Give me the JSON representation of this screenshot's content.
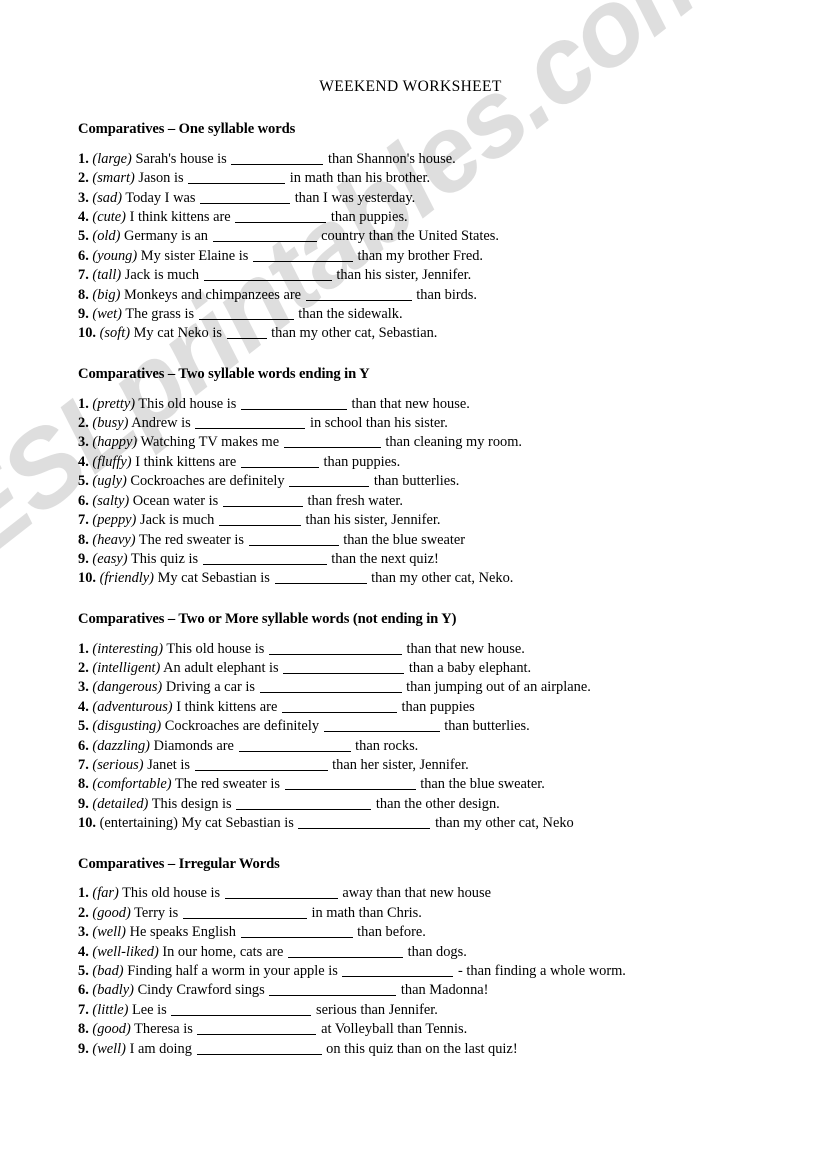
{
  "document": {
    "title": "WEEKEND WORKSHEET",
    "watermark": "ESLprintables.com"
  },
  "sections": [
    {
      "heading": "Comparatives – One syllable words",
      "items": [
        {
          "num": "1.",
          "cue": "(large)",
          "cue_italic": true,
          "before": "Sarah's house is",
          "blank": 92,
          "after": "than Shannon's house."
        },
        {
          "num": "2.",
          "cue": "(smart)",
          "cue_italic": true,
          "before": "Jason is",
          "blank": 97,
          "after": "in math than his brother."
        },
        {
          "num": "3.",
          "cue": "(sad)",
          "cue_italic": true,
          "before": "Today I was",
          "blank": 90,
          "after": "than I was yesterday."
        },
        {
          "num": "4.",
          "cue": "(cute)",
          "cue_italic": true,
          "before": "I think kittens are",
          "blank": 91,
          "after": "than puppies."
        },
        {
          "num": "5.",
          "cue": "(old)",
          "cue_italic": true,
          "before": "Germany is an",
          "blank": 104,
          "after": "country than the United States."
        },
        {
          "num": "6.",
          "cue": "(young)",
          "cue_italic": true,
          "before": "My sister Elaine is",
          "blank": 100,
          "after": "than my brother Fred."
        },
        {
          "num": "7.",
          "cue": "(tall)",
          "cue_italic": true,
          "before": "Jack is much",
          "blank": 128,
          "after": "than his sister, Jennifer."
        },
        {
          "num": "8.",
          "cue": "(big)",
          "cue_italic": true,
          "before": "Monkeys and chimpanzees are",
          "blank": 106,
          "after": "than birds."
        },
        {
          "num": "9.",
          "cue": "(wet)",
          "cue_italic": true,
          "before": "The grass is",
          "blank": 95,
          "after": "than the sidewalk."
        },
        {
          "num": "10.",
          "cue": "(soft)",
          "cue_italic": true,
          "before": "My cat Neko is",
          "blank": 40,
          "after": "than my other cat, Sebastian."
        }
      ]
    },
    {
      "heading": "Comparatives – Two syllable words ending in Y",
      "items": [
        {
          "num": "1.",
          "cue": "(pretty)",
          "cue_italic": true,
          "before": "This old house is",
          "blank": 106,
          "after": "than that new house."
        },
        {
          "num": "2.",
          "cue": "(busy)",
          "cue_italic": true,
          "before": "Andrew is",
          "blank": 110,
          "after": "in school than his sister."
        },
        {
          "num": "3.",
          "cue": "(happy)",
          "cue_italic": true,
          "before": "Watching TV makes me",
          "blank": 97,
          "after": "than cleaning my room."
        },
        {
          "num": "4.",
          "cue": "(fluffy)",
          "cue_italic": true,
          "before": "I think kittens are",
          "blank": 78,
          "after": "than puppies."
        },
        {
          "num": "5.",
          "cue": "(ugly)",
          "cue_italic": true,
          "before": "Cockroaches are definitely",
          "blank": 80,
          "after": "than butterlies."
        },
        {
          "num": "6.",
          "cue": "(salty)",
          "cue_italic": true,
          "before": "Ocean water is",
          "blank": 80,
          "after": "than fresh water."
        },
        {
          "num": "7.",
          "cue": "(peppy)",
          "cue_italic": true,
          "before": "Jack is much",
          "blank": 82,
          "after": "than his sister, Jennifer."
        },
        {
          "num": "8.",
          "cue": "(heavy)",
          "cue_italic": true,
          "before": "The red sweater is",
          "blank": 90,
          "after": "than the blue sweater"
        },
        {
          "num": "9.",
          "cue": "(easy)",
          "cue_italic": true,
          "before": "This quiz is",
          "blank": 124,
          "after": "than the next quiz!"
        },
        {
          "num": "10.",
          "cue": "(friendly)",
          "cue_italic": true,
          "before": "My cat Sebastian is",
          "blank": 92,
          "after": "than my other cat, Neko."
        }
      ]
    },
    {
      "heading": "Comparatives – Two or More syllable words (not ending in Y)",
      "items": [
        {
          "num": "1.",
          "cue": "(interesting)",
          "cue_italic": true,
          "before": "This old house is",
          "blank": 133,
          "after": "than that new house."
        },
        {
          "num": "2.",
          "cue": "(intelligent)",
          "cue_italic": true,
          "before": "An adult elephant is",
          "blank": 121,
          "after": "than a baby elephant."
        },
        {
          "num": "3.",
          "cue": "(dangerous)",
          "cue_italic": true,
          "before": "Driving a car is",
          "blank": 142,
          "after": "than jumping out of an airplane."
        },
        {
          "num": "4.",
          "cue": "(adventurous)",
          "cue_italic": true,
          "before": "I think kittens are",
          "blank": 115,
          "after": "than puppies"
        },
        {
          "num": "5.",
          "cue": "(disgusting)",
          "cue_italic": true,
          "before": "Cockroaches are definitely",
          "blank": 116,
          "after": "than butterlies."
        },
        {
          "num": "6.",
          "cue": "(dazzling)",
          "cue_italic": true,
          "before": "Diamonds are",
          "blank": 112,
          "after": "than rocks."
        },
        {
          "num": "7.",
          "cue": "(serious)",
          "cue_italic": true,
          "before": "Janet is",
          "blank": 133,
          "after": "than her sister, Jennifer."
        },
        {
          "num": "8.",
          "cue": "(comfortable)",
          "cue_italic": true,
          "before": "The red sweater is",
          "blank": 131,
          "after": "than the blue sweater."
        },
        {
          "num": "9.",
          "cue": "(detailed)",
          "cue_italic": true,
          "before": "This design is",
          "blank": 135,
          "after": "than the other design."
        },
        {
          "num": "10.",
          "cue": "(entertaining)",
          "cue_italic": false,
          "before": "My cat Sebastian is",
          "blank": 132,
          "after": "than my other cat, Neko"
        }
      ]
    },
    {
      "heading": "Comparatives – Irregular Words",
      "items": [
        {
          "num": "1.",
          "cue": "(far)",
          "cue_italic": true,
          "before": "This old house is",
          "blank": 113,
          "after": "away than that new house"
        },
        {
          "num": "2.",
          "cue": "(good)",
          "cue_italic": true,
          "before": "Terry is",
          "blank": 124,
          "after": "in math than Chris."
        },
        {
          "num": "3.",
          "cue": "(well)",
          "cue_italic": true,
          "before": "He speaks English",
          "blank": 112,
          "after": "than before."
        },
        {
          "num": "4.",
          "cue": "(well-liked)",
          "cue_italic": true,
          "before": "In our home, cats are",
          "blank": 115,
          "after": "than dogs."
        },
        {
          "num": "5.",
          "cue": "(bad)",
          "cue_italic": true,
          "before": "Finding half a worm in your apple is",
          "blank": 111,
          "after": "- than finding a whole worm."
        },
        {
          "num": "6.",
          "cue": "(badly)",
          "cue_italic": true,
          "before": "Cindy Crawford sings",
          "blank": 127,
          "after": "than Madonna!"
        },
        {
          "num": "7.",
          "cue": "(little)",
          "cue_italic": true,
          "before": "Lee is",
          "blank": 140,
          "after": "serious than Jennifer."
        },
        {
          "num": "8.",
          "cue": "(good)",
          "cue_italic": true,
          "before": "Theresa is",
          "blank": 119,
          "after": "at Volleyball than Tennis."
        },
        {
          "num": "9.",
          "cue": "(well)",
          "cue_italic": true,
          "before": "I am doing",
          "blank": 125,
          "after": "on this quiz than on the last quiz!"
        }
      ]
    }
  ]
}
